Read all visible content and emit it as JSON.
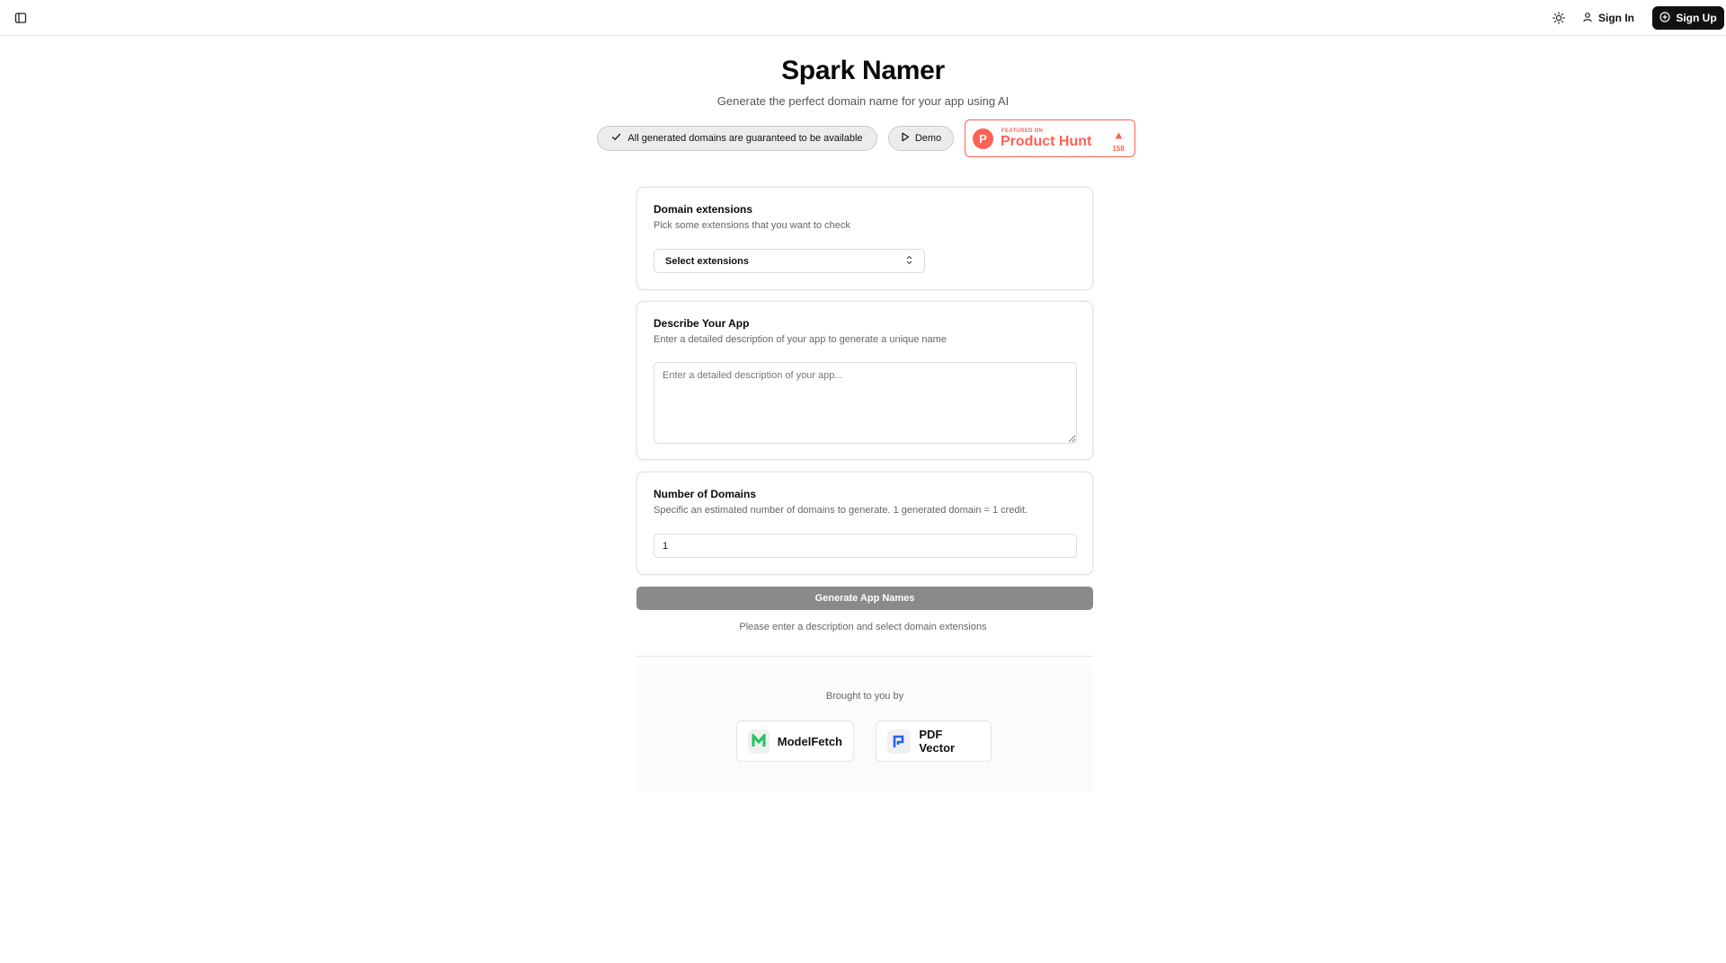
{
  "header": {
    "sidebar_toggle_icon": "panel-left-icon",
    "theme_icon": "sun-icon",
    "signin_label": "Sign In",
    "signup_label": "Sign Up"
  },
  "hero": {
    "title": "Spark Namer",
    "subtitle": "Generate the perfect domain name for your app using AI",
    "badge_available": "All generated domains are guaranteed to be available",
    "demo_label": "Demo"
  },
  "product_hunt": {
    "featured": "FEATURED ON",
    "name": "Product Hunt",
    "logo_letter": "P",
    "votes": "158",
    "color": "#ff6154"
  },
  "extensions_card": {
    "title": "Domain extensions",
    "description": "Pick some extensions that you want to check",
    "select_label": "Select extensions"
  },
  "describe_card": {
    "title": "Describe Your App",
    "description": "Enter a detailed description of your app to generate a unique name",
    "placeholder": "Enter a detailed description of your app...",
    "value": ""
  },
  "number_card": {
    "title": "Number of Domains",
    "description": "Specific an estimated number of domains to generate. 1 generated domain = 1 credit.",
    "value": "1"
  },
  "actions": {
    "generate_label": "Generate App Names",
    "hint": "Please enter a description and select domain extensions"
  },
  "sponsors": {
    "heading": "Brought to you by",
    "items": [
      {
        "name": "ModelFetch",
        "icon": "modelfetch-logo-icon",
        "color": "#22c55e"
      },
      {
        "name": "PDF Vector",
        "icon": "pdfvector-logo-icon",
        "color": "#2563eb"
      }
    ]
  }
}
